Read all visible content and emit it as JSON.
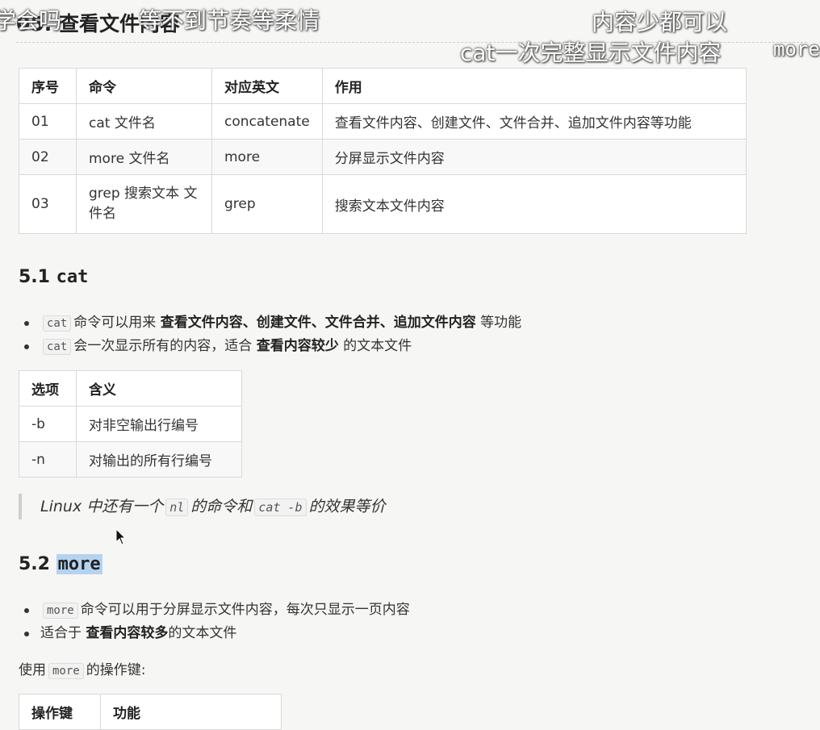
{
  "section": {
    "title": "05. 查看文件内容",
    "table": {
      "headers": [
        "序号",
        "命令",
        "对应英文",
        "作用"
      ],
      "rows": [
        [
          "01",
          "cat 文件名",
          "concatenate",
          "查看文件内容、创建文件、文件合并、追加文件内容等功能"
        ],
        [
          "02",
          "more 文件名",
          "more",
          "分屏显示文件内容"
        ],
        [
          "03",
          "grep 搜索文本 文件名",
          "grep",
          "搜索文本文件内容"
        ]
      ]
    }
  },
  "cat": {
    "heading_num": "5.1",
    "heading_code": "cat",
    "bullet1": {
      "code": "cat",
      "pre": "命令可以用来",
      "bold": "查看文件内容、创建文件、文件合并、追加文件内容",
      "post": "等功能"
    },
    "bullet2": {
      "code": "cat",
      "pre": "会一次显示所有的内容，适合",
      "bold": "查看内容较少",
      "post": "的文本文件"
    },
    "options": {
      "headers": [
        "选项",
        "含义"
      ],
      "rows": [
        [
          "-b",
          "对非空输出行编号"
        ],
        [
          "-n",
          "对输出的所有行编号"
        ]
      ]
    },
    "quote": {
      "pre": "Linux 中还有一个",
      "code1": "nl",
      "mid": "的命令和",
      "code2": "cat -b",
      "post": "的效果等价"
    }
  },
  "more": {
    "heading_num": "5.2",
    "heading_code": "more",
    "bullet1": {
      "code": "more",
      "post": "命令可以用于分屏显示文件内容，每次只显示一页内容"
    },
    "bullet2": {
      "pre": "适合于",
      "bold": "查看内容较多",
      "post": "的文本文件"
    },
    "para": {
      "pre": "使用",
      "code": "more",
      "post": "的操作键:"
    },
    "keys_headers": [
      "操作键",
      "功能"
    ]
  },
  "overlays": {
    "top_left": "学会吗",
    "top_mid": "等不到节奏等柔情",
    "right_1": "内容少都可以",
    "right_2": "cat一次完整显示文件内容",
    "right_3": "more"
  }
}
